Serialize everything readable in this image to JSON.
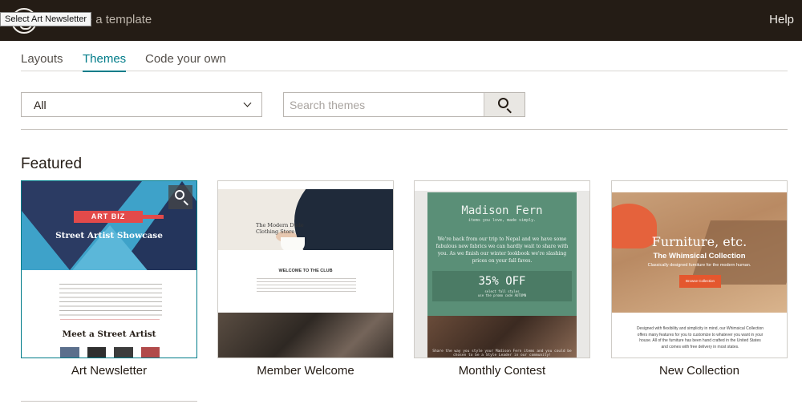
{
  "topbar": {
    "app_title": "Create a template",
    "help_label": "Help",
    "tooltip": "Select Art Newsletter"
  },
  "tabs": [
    {
      "label": "Layouts",
      "active": false
    },
    {
      "label": "Themes",
      "active": true
    },
    {
      "label": "Code your own",
      "active": false
    }
  ],
  "filters": {
    "category_selected": "All",
    "search_placeholder": "Search themes"
  },
  "section_title": "Featured",
  "colors": {
    "topbar_bg": "#241c15",
    "accent": "#007c89",
    "selected_border": "#007c89"
  },
  "cards": [
    {
      "name": "Art Newsletter",
      "selected": true,
      "preview": {
        "logo_text": "ART BIZ",
        "hero_title": "Street Artist Showcase",
        "subheading": "Meet a Street Artist"
      }
    },
    {
      "name": "Member Welcome",
      "selected": false,
      "preview": {
        "brand": "The Modern Dude Clothing Store",
        "heading": "WELCOME TO THE CLUB"
      }
    },
    {
      "name": "Monthly Contest",
      "selected": false,
      "preview": {
        "title": "Madison Fern",
        "tagline": "items you love, made simply.",
        "body": "We're back from our trip to Nepal and we have some fabulous new fabrics we can hardly wait to share with you. As we finish our winter lookbook we're slashing prices on your fall faves.",
        "offer": "35% OFF",
        "offer_sub1": "select fall styles",
        "offer_sub2": "use the promo code AUTUMN",
        "caption": "Share the way you style your Madison Fern items and you could be chosen to be a Style Leader in our community!"
      }
    },
    {
      "name": "New Collection",
      "selected": false,
      "preview": {
        "headline": "Furniture, etc.",
        "collection": "The Whimsical Collection",
        "subline": "Classically designed furniture for the modern human.",
        "button": "Browse Collection",
        "body": "Designed with flexibility and simplicity in mind, our Whimsical Collection offers many features for you to customize to whatever you want in your house. All of the furniture has been hand crafted in the United States and comes with free delivery in most states."
      }
    }
  ]
}
